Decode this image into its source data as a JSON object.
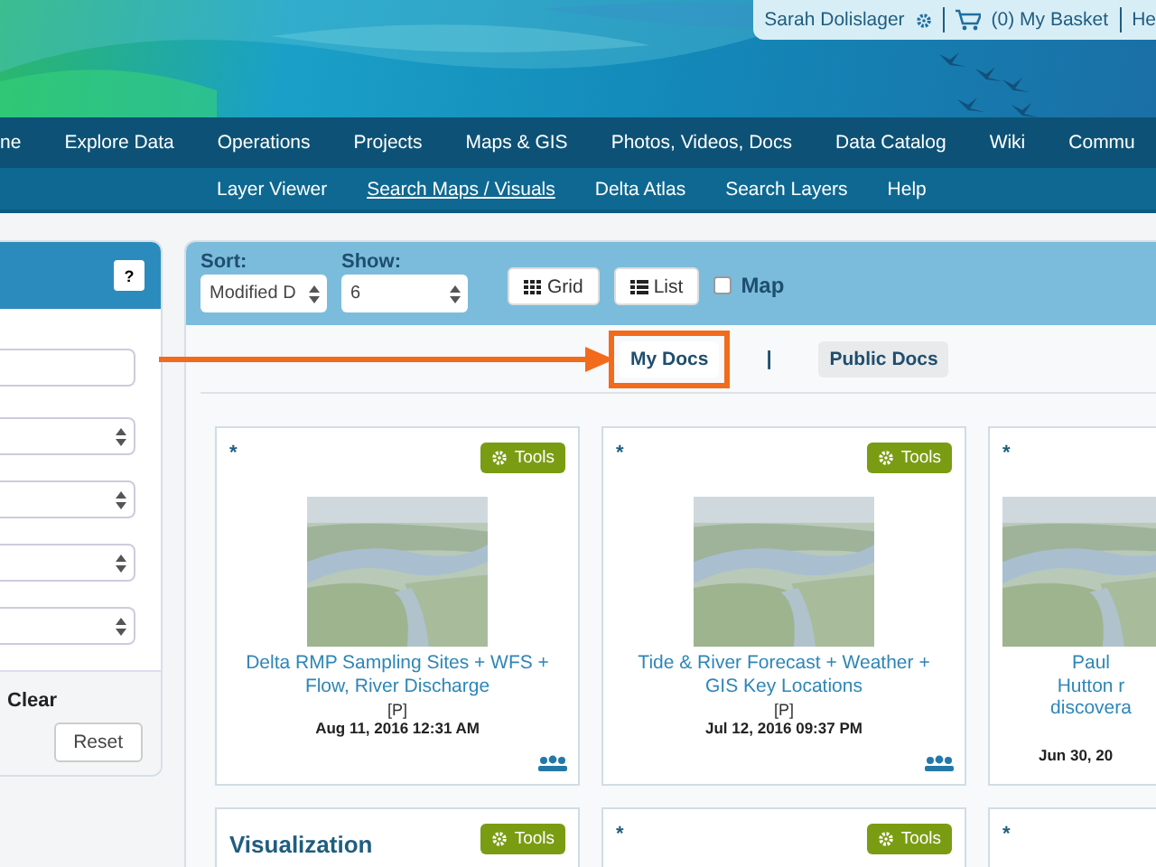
{
  "user_bar": {
    "user": "Sarah Dolislager",
    "basket": "(0) My Basket",
    "help": "He"
  },
  "nav": [
    {
      "label": "ne"
    },
    {
      "label": "Explore Data"
    },
    {
      "label": "Operations"
    },
    {
      "label": "Projects"
    },
    {
      "label": "Maps & GIS"
    },
    {
      "label": "Photos, Videos, Docs"
    },
    {
      "label": "Data Catalog"
    },
    {
      "label": "Wiki"
    },
    {
      "label": "Commu"
    }
  ],
  "subnav": [
    {
      "label": "Layer Viewer",
      "selected": false
    },
    {
      "label": "Search Maps / Visuals",
      "selected": true
    },
    {
      "label": "Delta Atlas",
      "selected": false
    },
    {
      "label": "Search Layers",
      "selected": false
    },
    {
      "label": "Help",
      "selected": false
    }
  ],
  "filter_panel": {
    "help": "?",
    "fields": [
      {
        "kind": "text"
      },
      {
        "kind": "select"
      },
      {
        "kind": "select"
      },
      {
        "kind": "select"
      },
      {
        "kind": "select"
      }
    ],
    "clear": "Clear",
    "reset": "Reset"
  },
  "toolbar": {
    "sort_label": "Sort:",
    "sort_value": "Modified D",
    "show_label": "Show:",
    "show_value": "6",
    "grid": "Grid",
    "list": "List",
    "map": {
      "label": "Map",
      "checked": false
    }
  },
  "tabs": [
    {
      "label": "My Docs",
      "selected": true,
      "highlighted": true
    },
    {
      "label": "Public Docs",
      "selected": false,
      "highlighted": false
    }
  ],
  "tab_separator": "|",
  "cards": [
    {
      "marker": "*",
      "tools": "Tools",
      "title": "Delta RMP Sampling Sites + WFS + Flow, River Discharge",
      "flag": "[P]",
      "date": "Aug 11, 2016 12:31 AM",
      "shared": true
    },
    {
      "marker": "*",
      "tools": "Tools",
      "title": "Tide & River Forecast + Weather + GIS Key Locations",
      "flag": "[P]",
      "date": "Jul 12, 2016 09:37 PM",
      "shared": true
    },
    {
      "marker": "*",
      "title": "Paul Hutton r discovera",
      "date": "Jun 30, 20"
    },
    {
      "heading": "Visualization",
      "tools": "Tools"
    },
    {
      "marker": "*",
      "tools": "Tools"
    },
    {
      "marker": "*"
    }
  ]
}
